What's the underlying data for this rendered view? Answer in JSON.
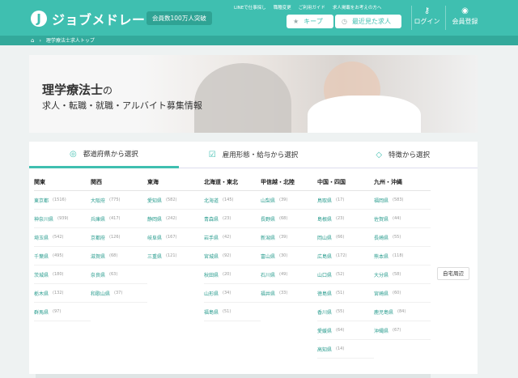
{
  "header": {
    "logo_mark": "J",
    "logo_text": "ジョブメドレー",
    "members_badge": "会員数100万人突破",
    "top_links": [
      "LINEで仕事探し",
      "職種変更",
      "ご利用ガイド",
      "求人掲載をお考えの方へ"
    ],
    "keep_label": "キープ",
    "recent_label": "最近見た求人",
    "login_label": "ログイン",
    "register_label": "会員登録",
    "accent_color": "#3fbfb0"
  },
  "breadcrumb": {
    "home_icon": "home-icon",
    "current": "理学療法士求人トップ"
  },
  "hero": {
    "title": "理学療法士",
    "title_suffix": "の",
    "subtitle": "求人・転職・就職・アルバイト募集情報"
  },
  "tabs": [
    {
      "label": "都道府県から選択",
      "icon": "location-pin-icon",
      "active": true
    },
    {
      "label": "雇用形態・給与から選択",
      "icon": "check-box-icon",
      "active": false
    },
    {
      "label": "特徴から選択",
      "icon": "tag-icon",
      "active": false
    }
  ],
  "regions": [
    {
      "name": "関東",
      "prefs": [
        {
          "name": "東京都",
          "count": "(1516)"
        },
        {
          "name": "神奈川県",
          "count": "(939)"
        },
        {
          "name": "埼玉県",
          "count": "(542)"
        },
        {
          "name": "千葉県",
          "count": "(495)"
        },
        {
          "name": "茨城県",
          "count": "(180)"
        },
        {
          "name": "栃木県",
          "count": "(132)"
        },
        {
          "name": "群馬県",
          "count": "(97)"
        }
      ]
    },
    {
      "name": "関西",
      "prefs": [
        {
          "name": "大阪府",
          "count": "(775)"
        },
        {
          "name": "兵庫県",
          "count": "(417)"
        },
        {
          "name": "京都府",
          "count": "(126)"
        },
        {
          "name": "滋賀県",
          "count": "(68)"
        },
        {
          "name": "奈良県",
          "count": "(63)"
        },
        {
          "name": "和歌山県",
          "count": "(37)"
        }
      ]
    },
    {
      "name": "東海",
      "prefs": [
        {
          "name": "愛知県",
          "count": "(582)"
        },
        {
          "name": "静岡県",
          "count": "(242)"
        },
        {
          "name": "岐阜県",
          "count": "(167)"
        },
        {
          "name": "三重県",
          "count": "(121)"
        }
      ]
    },
    {
      "name": "北海道・東北",
      "prefs": [
        {
          "name": "北海道",
          "count": "(145)"
        },
        {
          "name": "青森県",
          "count": "(23)"
        },
        {
          "name": "岩手県",
          "count": "(42)"
        },
        {
          "name": "宮城県",
          "count": "(92)"
        },
        {
          "name": "秋田県",
          "count": "(20)"
        },
        {
          "name": "山形県",
          "count": "(34)"
        },
        {
          "name": "福島県",
          "count": "(51)"
        }
      ]
    },
    {
      "name": "甲信越・北陸",
      "prefs": [
        {
          "name": "山梨県",
          "count": "(39)"
        },
        {
          "name": "長野県",
          "count": "(68)"
        },
        {
          "name": "新潟県",
          "count": "(39)"
        },
        {
          "name": "富山県",
          "count": "(30)"
        },
        {
          "name": "石川県",
          "count": "(49)"
        },
        {
          "name": "福井県",
          "count": "(33)"
        }
      ]
    },
    {
      "name": "中国・四国",
      "prefs": [
        {
          "name": "鳥取県",
          "count": "(17)"
        },
        {
          "name": "島根県",
          "count": "(23)"
        },
        {
          "name": "岡山県",
          "count": "(66)"
        },
        {
          "name": "広島県",
          "count": "(172)"
        },
        {
          "name": "山口県",
          "count": "(52)"
        },
        {
          "name": "徳島県",
          "count": "(51)"
        },
        {
          "name": "香川県",
          "count": "(55)"
        },
        {
          "name": "愛媛県",
          "count": "(64)"
        },
        {
          "name": "高知県",
          "count": "(14)"
        }
      ]
    },
    {
      "name": "九州・沖縄",
      "prefs": [
        {
          "name": "福岡県",
          "count": "(583)"
        },
        {
          "name": "佐賀県",
          "count": "(44)"
        },
        {
          "name": "長崎県",
          "count": "(55)"
        },
        {
          "name": "熊本県",
          "count": "(118)"
        },
        {
          "name": "大分県",
          "count": "(58)"
        },
        {
          "name": "宮崎県",
          "count": "(60)"
        },
        {
          "name": "鹿児島県",
          "count": "(84)"
        },
        {
          "name": "沖縄県",
          "count": "(67)"
        }
      ]
    }
  ],
  "home_area_button": "自宅周辺"
}
